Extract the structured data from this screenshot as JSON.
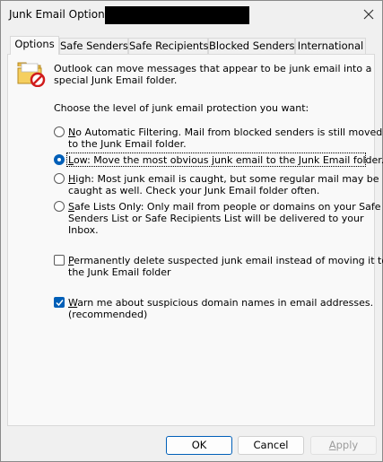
{
  "window": {
    "title": "Junk Email Options",
    "close_icon": "close-icon"
  },
  "tabs": [
    {
      "label": "Options",
      "active": true
    },
    {
      "label": "Safe Senders",
      "active": false
    },
    {
      "label": "Safe Recipients",
      "active": false
    },
    {
      "label": "Blocked Senders",
      "active": false
    },
    {
      "label": "International",
      "active": false
    }
  ],
  "options": {
    "intro_line1": "Outlook can move messages that appear to be junk email into a",
    "intro_line2": "special Junk Email folder.",
    "choose_label": "Choose the level of junk email protection you want:",
    "levels": [
      {
        "key": "N",
        "line1_rest": "o Automatic Filtering. Mail from blocked senders is still moved",
        "line2": "to the Junk Email folder.",
        "selected": false
      },
      {
        "key": "L",
        "line1_rest": "ow: Move the most obvious junk email to the Junk Email folder.",
        "line2": "",
        "selected": true
      },
      {
        "key": "H",
        "line1_rest": "igh: Most junk email is caught, but some regular mail may be",
        "line2": "caught as well. Check your Junk Email folder often.",
        "selected": false
      },
      {
        "key": "S",
        "line1_rest": "afe Lists Only: Only mail from people or domains on your Safe",
        "line2": "Senders List or Safe Recipients List will be delivered to your",
        "line3": "Inbox.",
        "selected": false
      }
    ],
    "permanent_delete": {
      "key": "P",
      "line1_rest": "ermanently delete suspected junk email instead of moving it to",
      "line2": "the Junk Email folder",
      "checked": false
    },
    "warn_domains": {
      "key": "W",
      "line1_rest": "arn me about suspicious domain names in email addresses.",
      "line2": "(recommended)",
      "checked": true
    }
  },
  "buttons": {
    "ok": "OK",
    "cancel": "Cancel",
    "apply_key": "A",
    "apply_rest": "pply"
  },
  "colors": {
    "accent": "#005fb8",
    "background": "#f0f0f0",
    "panel": "#f9f9f9"
  }
}
